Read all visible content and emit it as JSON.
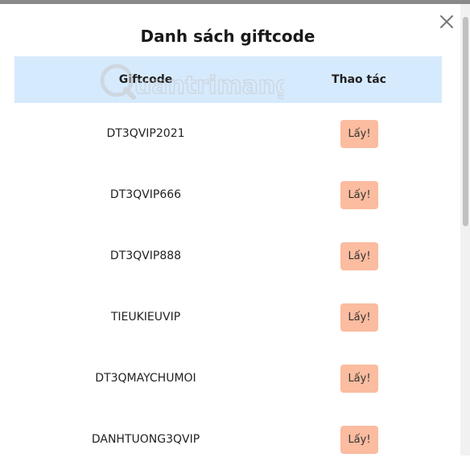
{
  "dialog": {
    "title": "Danh sách giftcode"
  },
  "table": {
    "headers": [
      "Giftcode",
      "Thao tác"
    ],
    "rows": [
      {
        "code": "DT3QVIP2021",
        "action": "Lấy!"
      },
      {
        "code": "DT3QVIP666",
        "action": "Lấy!"
      },
      {
        "code": "DT3QVIP888",
        "action": "Lấy!"
      },
      {
        "code": "TIEUKIEUVIP",
        "action": "Lấy!"
      },
      {
        "code": "DT3QMAYCHUMOI",
        "action": "Lấy!"
      },
      {
        "code": "DANHTUONG3QVIP",
        "action": "Lấy!"
      }
    ]
  },
  "watermark": {
    "text": "uantrimang"
  },
  "icons": {
    "close": "close-icon"
  },
  "colors": {
    "header_bg": "#d6eafe",
    "button_bg": "#fbbca0",
    "top_bar": "#8a8a8a"
  }
}
